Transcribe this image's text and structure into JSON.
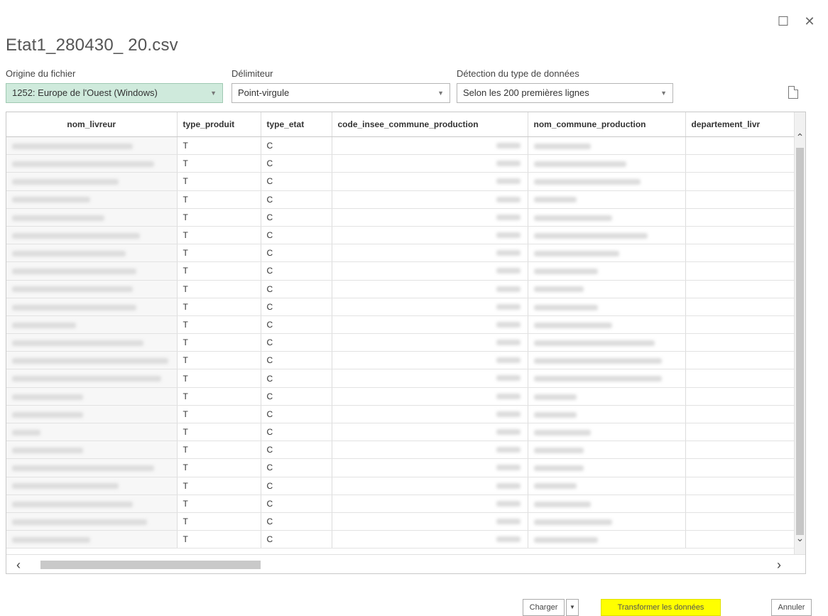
{
  "window": {
    "maximize_glyph": "☐",
    "close_glyph": "✕"
  },
  "title": "Etat1_280430_ 20.csv",
  "options": {
    "origin_label": "Origine du fichier",
    "origin_value": "1252: Europe de l'Ouest (Windows)",
    "delimiter_label": "Délimiteur",
    "delimiter_value": "Point-virgule",
    "detection_label": "Détection du type de données",
    "detection_value": "Selon les 200 premières lignes"
  },
  "table": {
    "columns": [
      "nom_livreur",
      "type_produit",
      "type_etat",
      "code_insee_commune_production",
      "nom_commune_production",
      "departement_livr"
    ],
    "rows": [
      [
        "",
        "T",
        "C",
        "",
        "",
        ""
      ],
      [
        "",
        "T",
        "C",
        "",
        "",
        ""
      ],
      [
        "",
        "T",
        "C",
        "",
        "",
        ""
      ],
      [
        "",
        "T",
        "C",
        "",
        "",
        ""
      ],
      [
        "",
        "T",
        "C",
        "",
        "",
        ""
      ],
      [
        "",
        "T",
        "C",
        "",
        "",
        ""
      ],
      [
        "",
        "T",
        "C",
        "",
        "",
        ""
      ],
      [
        "",
        "T",
        "C",
        "",
        "",
        ""
      ],
      [
        "",
        "T",
        "C",
        "",
        "",
        ""
      ],
      [
        "",
        "T",
        "C",
        "",
        "",
        ""
      ],
      [
        "",
        "T",
        "C",
        "",
        "",
        ""
      ],
      [
        "",
        "T",
        "C",
        "",
        "",
        ""
      ],
      [
        "",
        "T",
        "C",
        "",
        "",
        ""
      ],
      [
        "",
        "T",
        "C",
        "",
        "",
        ""
      ],
      [
        "",
        "T",
        "C",
        "",
        "",
        ""
      ],
      [
        "",
        "T",
        "C",
        "",
        "",
        ""
      ],
      [
        "",
        "T",
        "C",
        "",
        "",
        ""
      ],
      [
        "",
        "T",
        "C",
        "",
        "",
        ""
      ],
      [
        "",
        "T",
        "C",
        "",
        "",
        ""
      ],
      [
        "",
        "T",
        "C",
        "",
        "",
        ""
      ],
      [
        "",
        "T",
        "C",
        "",
        "",
        ""
      ],
      [
        "",
        "T",
        "C",
        "",
        "",
        ""
      ],
      [
        "",
        "T",
        "C",
        "",
        "",
        ""
      ]
    ]
  },
  "footer": {
    "load_label": "Charger",
    "transform_label": "Transformer les données",
    "cancel_label": "Annuler"
  },
  "colors": {
    "origin_highlight": "#cfeadc",
    "transform_highlight": "#ffff00"
  }
}
